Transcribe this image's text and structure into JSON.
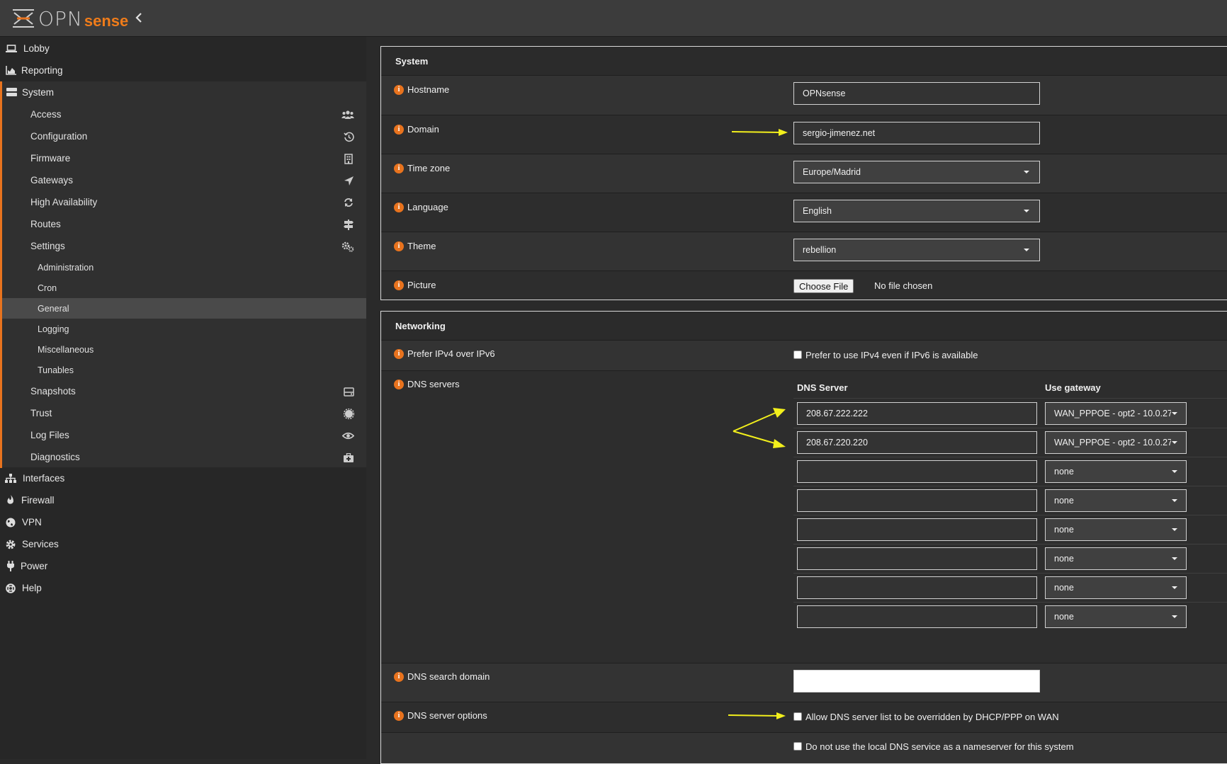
{
  "app": {
    "logo_text_opn": "OPN",
    "logo_text_sense": "sense",
    "accent_color": "#e8731e"
  },
  "sidebar": {
    "top_items": [
      {
        "label": "Lobby",
        "icon": "laptop-icon"
      },
      {
        "label": "Reporting",
        "icon": "area-chart-icon"
      },
      {
        "label": "System",
        "icon": "server-icon"
      }
    ],
    "system_items": [
      {
        "label": "Access",
        "icon": "users-icon"
      },
      {
        "label": "Configuration",
        "icon": "history-icon"
      },
      {
        "label": "Firmware",
        "icon": "building-icon"
      },
      {
        "label": "Gateways",
        "icon": "location-arrow-icon"
      },
      {
        "label": "High Availability",
        "icon": "refresh-icon"
      },
      {
        "label": "Routes",
        "icon": "map-signs-icon"
      },
      {
        "label": "Settings",
        "icon": "cogs-icon"
      }
    ],
    "settings_items": [
      {
        "label": "Administration"
      },
      {
        "label": "Cron"
      },
      {
        "label": "General",
        "active": true
      },
      {
        "label": "Logging"
      },
      {
        "label": "Miscellaneous"
      },
      {
        "label": "Tunables"
      }
    ],
    "system_items_after": [
      {
        "label": "Snapshots",
        "icon": "hdd-icon"
      },
      {
        "label": "Trust",
        "icon": "certificate-icon"
      },
      {
        "label": "Log Files",
        "icon": "eye-icon"
      },
      {
        "label": "Diagnostics",
        "icon": "medkit-icon"
      }
    ],
    "bottom_items": [
      {
        "label": "Interfaces",
        "icon": "sitemap-icon"
      },
      {
        "label": "Firewall",
        "icon": "fire-icon"
      },
      {
        "label": "VPN",
        "icon": "globe-icon"
      },
      {
        "label": "Services",
        "icon": "cog-icon"
      },
      {
        "label": "Power",
        "icon": "plug-icon"
      },
      {
        "label": "Help",
        "icon": "life-ring-icon"
      }
    ]
  },
  "system_panel": {
    "title": "System",
    "hostname": {
      "label": "Hostname",
      "value": "OPNsense"
    },
    "domain": {
      "label": "Domain",
      "value": "sergio-jimenez.net"
    },
    "timezone": {
      "label": "Time zone",
      "value": "Europe/Madrid"
    },
    "language": {
      "label": "Language",
      "value": "English"
    },
    "theme": {
      "label": "Theme",
      "value": "rebellion"
    },
    "picture": {
      "label": "Picture",
      "button": "Choose File",
      "status": "No file chosen"
    }
  },
  "networking_panel": {
    "title": "Networking",
    "prefer_ipv4": {
      "label": "Prefer IPv4 over IPv6",
      "checkbox_label": "Prefer to use IPv4 even if IPv6 is available",
      "checked": false
    },
    "dns_servers": {
      "label": "DNS servers",
      "col_server": "DNS Server",
      "col_gateway": "Use gateway",
      "rows": [
        {
          "server": "208.67.222.222",
          "gateway": "WAN_PPPOE - opt2 - 10.0.27"
        },
        {
          "server": "208.67.220.220",
          "gateway": "WAN_PPPOE - opt2 - 10.0.27"
        },
        {
          "server": "",
          "gateway": "none"
        },
        {
          "server": "",
          "gateway": "none"
        },
        {
          "server": "",
          "gateway": "none"
        },
        {
          "server": "",
          "gateway": "none"
        },
        {
          "server": "",
          "gateway": "none"
        },
        {
          "server": "",
          "gateway": "none"
        }
      ]
    },
    "dns_search_domain": {
      "label": "DNS search domain",
      "value": ""
    },
    "dns_server_options": {
      "label": "DNS server options",
      "option1": "Allow DNS server list to be overridden by DHCP/PPP on WAN",
      "option2": "Do not use the local DNS service as a nameserver for this system"
    }
  },
  "annotation_color": "#f2ef1c"
}
